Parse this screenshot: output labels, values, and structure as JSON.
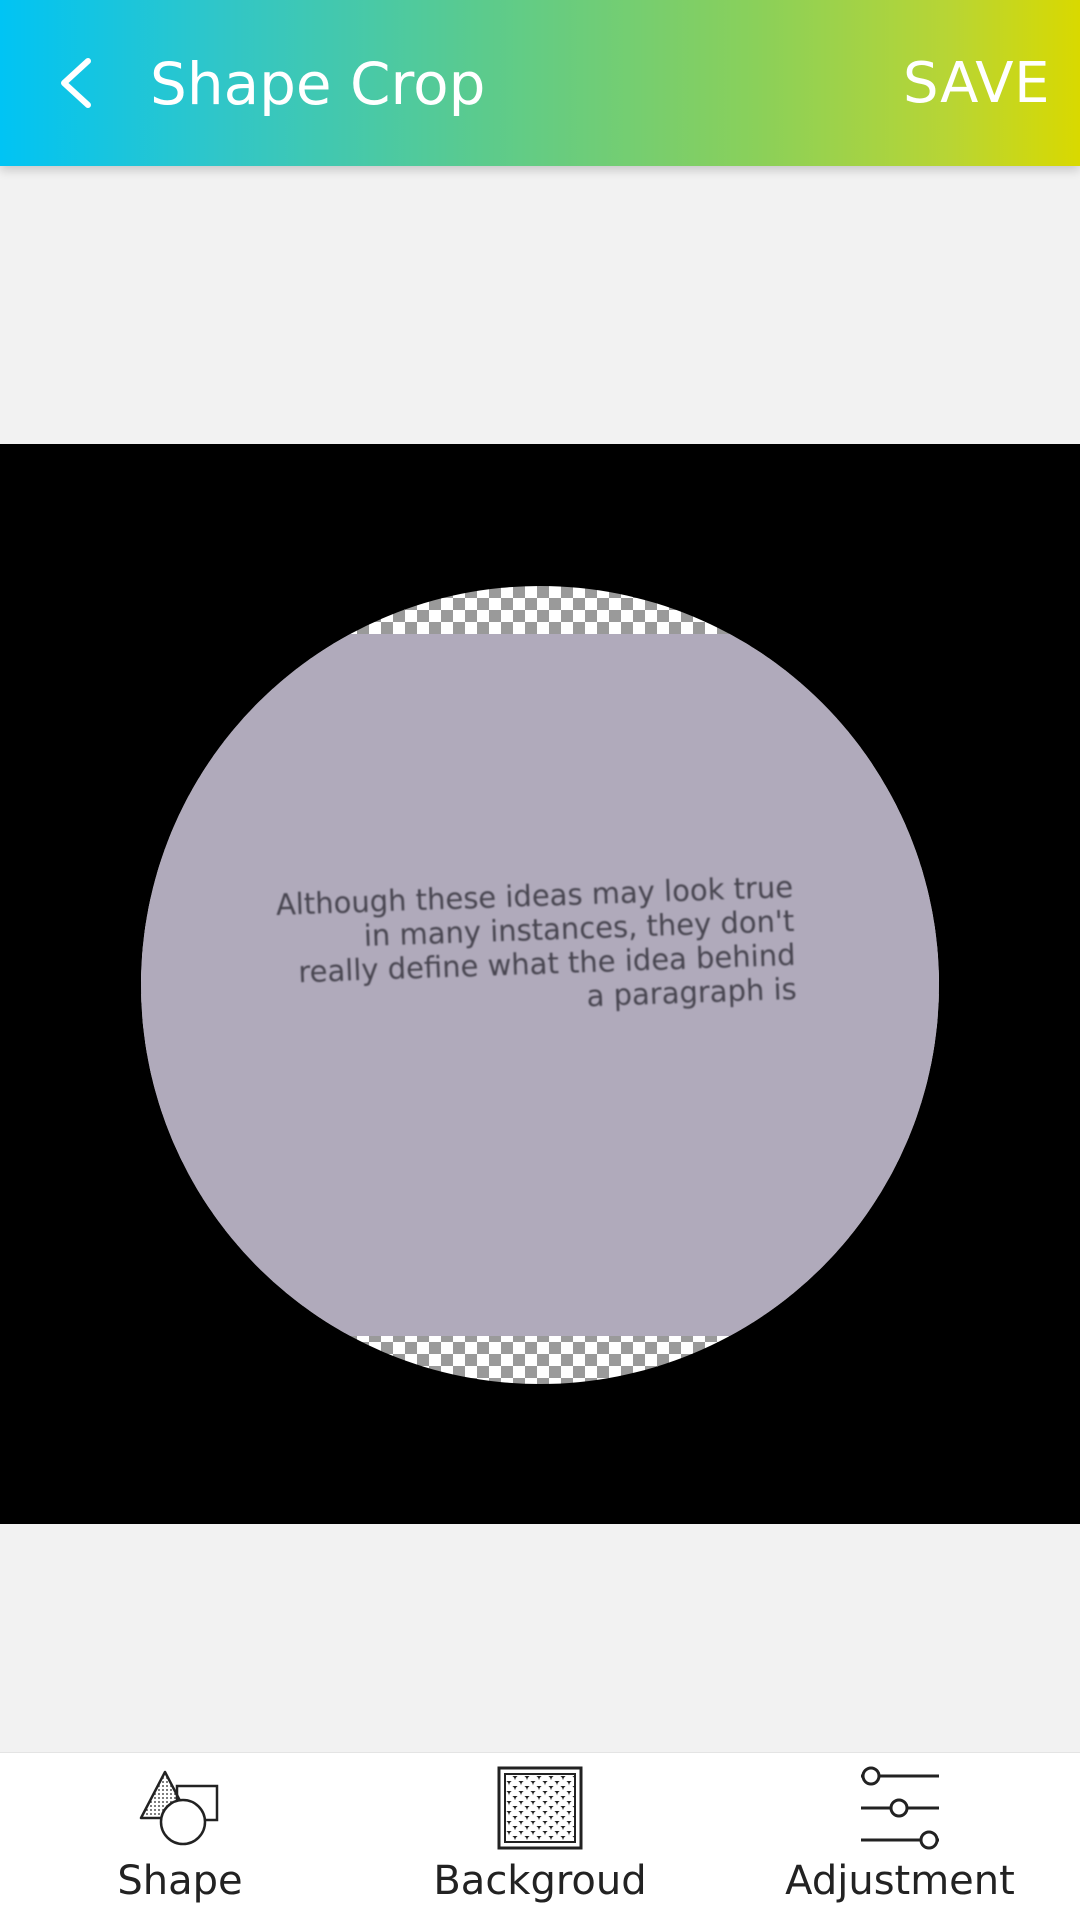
{
  "header": {
    "title": "Shape Crop",
    "save_label": "SAVE",
    "back_icon": "chevron-left-icon"
  },
  "preview": {
    "image_text": "Although these ideas may look true in many instances, they don't really define what the idea behind a paragraph is"
  },
  "toolbar": {
    "items": [
      {
        "label": "Shape",
        "icon": "shapes-icon"
      },
      {
        "label": "Backgroud",
        "icon": "pattern-icon"
      },
      {
        "label": "Adjustment",
        "icon": "sliders-icon"
      }
    ]
  },
  "colors": {
    "gradient_start": "#00c4f4",
    "gradient_end": "#d9d900",
    "canvas_background": "#000000",
    "photo_color": "#b0aabb"
  }
}
